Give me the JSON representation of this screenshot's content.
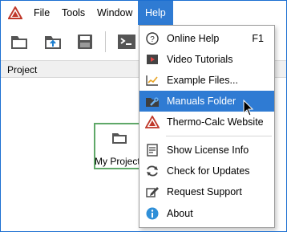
{
  "colors": {
    "accent": "#2f7bd3",
    "window_border": "#1c6fd1",
    "project_node": "#5fa868"
  },
  "app": {
    "logo_icon": "thermo-calc-logo"
  },
  "menubar": {
    "file": "File",
    "tools": "Tools",
    "window": "Window",
    "help": "Help"
  },
  "toolbar": {
    "buttons": [
      {
        "icon": "open-folder-icon"
      },
      {
        "icon": "upload-folder-icon"
      },
      {
        "icon": "save-icon"
      },
      {
        "icon": "console-icon"
      }
    ]
  },
  "panel": {
    "title": "Project"
  },
  "project": {
    "node_label": "My Project"
  },
  "help_menu": {
    "items": [
      {
        "label": "Online Help",
        "shortcut": "F1",
        "icon": "question-circle-icon"
      },
      {
        "label": "Video Tutorials",
        "icon": "video-play-icon"
      },
      {
        "label": "Example Files...",
        "icon": "line-chart-icon"
      },
      {
        "label": "Manuals Folder",
        "icon": "wrench-folder-icon",
        "highlighted": true
      },
      {
        "label": "Thermo-Calc Website",
        "icon": "thermo-calc-logo-icon"
      },
      {
        "label": "Show License Info",
        "icon": "license-icon"
      },
      {
        "label": "Check for Updates",
        "icon": "refresh-icon"
      },
      {
        "label": "Request Support",
        "icon": "edit-icon"
      },
      {
        "label": "About",
        "icon": "info-icon"
      }
    ]
  }
}
